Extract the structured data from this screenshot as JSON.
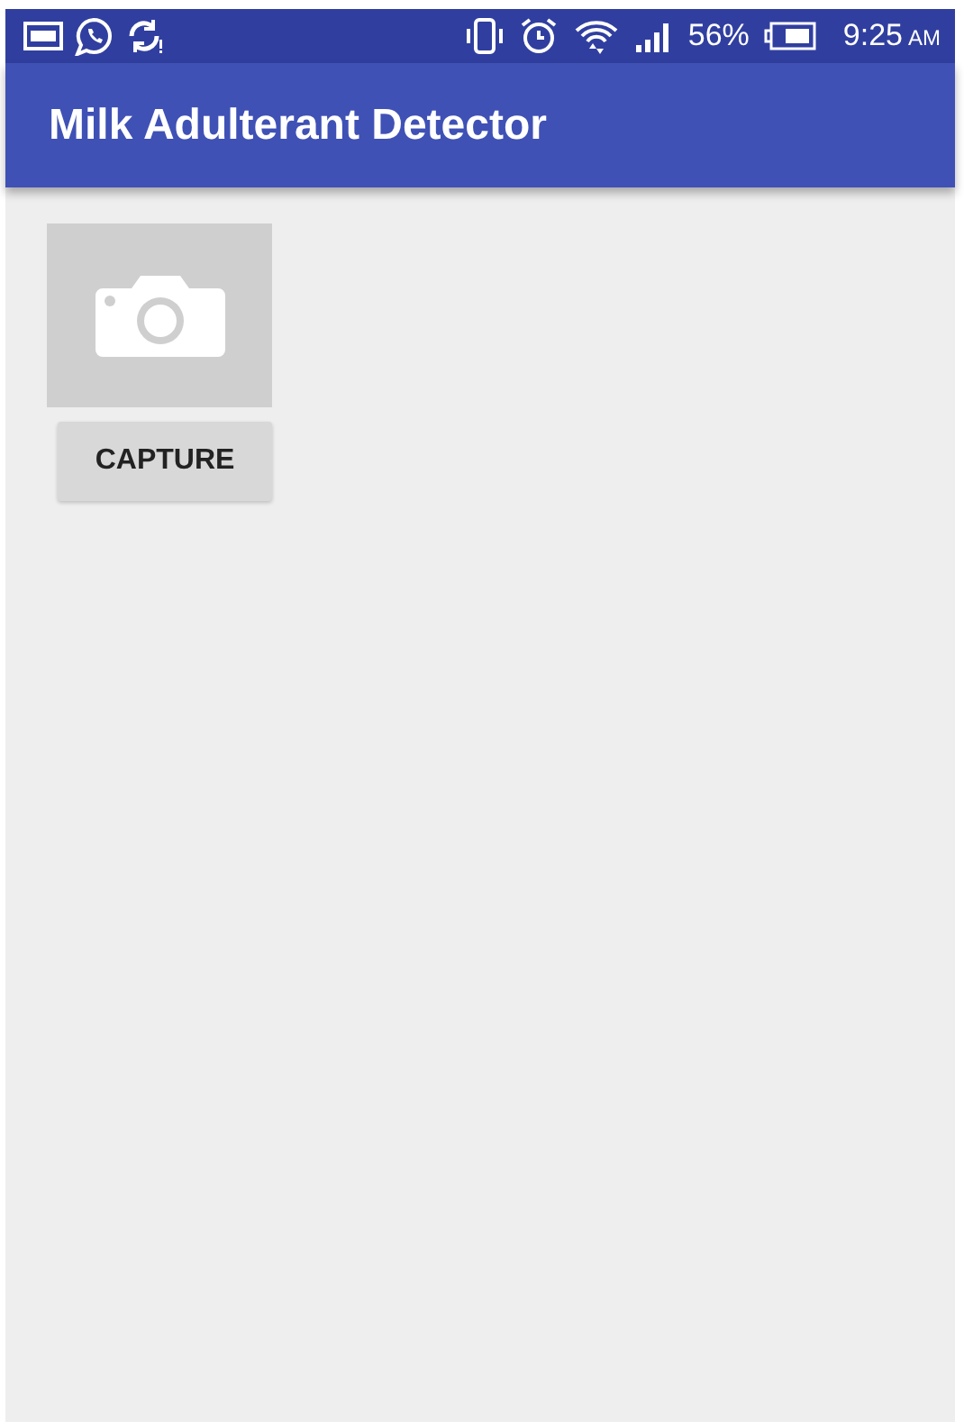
{
  "status_bar": {
    "battery": "56%",
    "time": "9:25",
    "meridiem": "AM"
  },
  "app_bar": {
    "title": "Milk Adulterant Detector"
  },
  "capture": {
    "button": "CAPTURE"
  }
}
